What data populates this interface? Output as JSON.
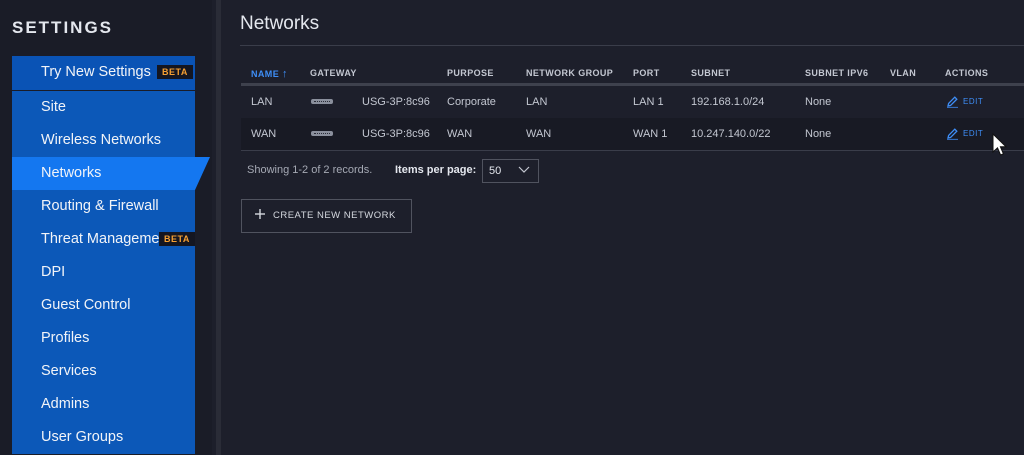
{
  "sidebar": {
    "title": "SETTINGS",
    "items": [
      {
        "label": "Try New Settings",
        "badge": "BETA"
      },
      {
        "label": "Site"
      },
      {
        "label": "Wireless Networks"
      },
      {
        "label": "Networks",
        "active": true
      },
      {
        "label": "Routing & Firewall"
      },
      {
        "label": "Threat Management",
        "badge": "BETA"
      },
      {
        "label": "DPI"
      },
      {
        "label": "Guest Control"
      },
      {
        "label": "Profiles"
      },
      {
        "label": "Services"
      },
      {
        "label": "Admins"
      },
      {
        "label": "User Groups"
      }
    ]
  },
  "page": {
    "title": "Networks"
  },
  "table": {
    "sort_indicator": "↑",
    "columns": [
      "NAME",
      "GATEWAY",
      "PURPOSE",
      "NETWORK GROUP",
      "PORT",
      "SUBNET",
      "SUBNET IPV6",
      "VLAN",
      "ACTIONS"
    ],
    "rows": [
      {
        "name": "LAN",
        "gateway": "USG-3P:8c96",
        "purpose": "Corporate",
        "network_group": "LAN",
        "port": "LAN 1",
        "subnet": "192.168.1.0/24",
        "subnet_ipv6": "None",
        "vlan": "",
        "action": "EDIT"
      },
      {
        "name": "WAN",
        "gateway": "USG-3P:8c96",
        "purpose": "WAN",
        "network_group": "WAN",
        "port": "WAN 1",
        "subnet": "10.247.140.0/22",
        "subnet_ipv6": "None",
        "vlan": "",
        "action": "EDIT"
      }
    ]
  },
  "footer": {
    "records_text": "Showing 1-2 of 2 records.",
    "items_per_page_label": "Items per page:",
    "items_per_page_value": "50"
  },
  "create_button": {
    "label": "CREATE NEW NETWORK"
  },
  "colors": {
    "accent": "#1477f0",
    "sidebar_item": "#0c58b8",
    "beta": "#f6a033",
    "link": "#3e8ef7"
  }
}
